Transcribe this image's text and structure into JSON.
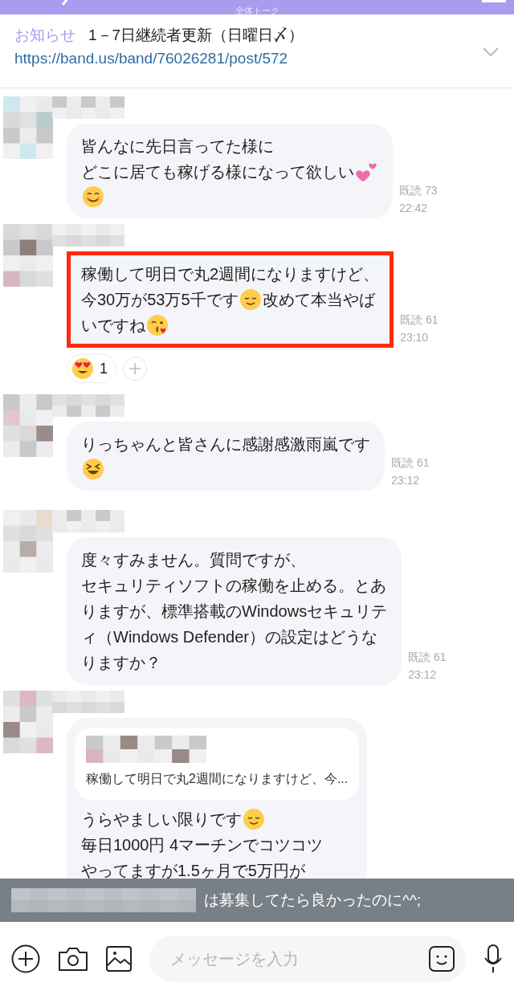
{
  "header": {
    "title": "全体トーク"
  },
  "notice": {
    "label": "お知らせ",
    "title": "1－7日継続者更新（日曜日〆）",
    "link": "https://band.us/band/76026281/post/572",
    "expanded": false
  },
  "messages": [
    {
      "highlighted": false,
      "lines": [
        [
          {
            "kind": "text",
            "text": "皆んなに先日言ってた様に"
          }
        ],
        [
          {
            "kind": "text",
            "text": "どこに居ても稼げる様になって欲しい"
          },
          {
            "kind": "hearts"
          }
        ],
        [
          {
            "kind": "smile"
          }
        ]
      ],
      "read": "既読 73",
      "time": "22:42"
    },
    {
      "highlighted": true,
      "lines": [
        [
          {
            "kind": "text",
            "text": "稼働して明日で丸2週間になりますけど、"
          }
        ],
        [
          {
            "kind": "text",
            "text": "今30万が53万5千です"
          },
          {
            "kind": "relieved"
          },
          {
            "kind": "text",
            "text": "改めて本当やば"
          }
        ],
        [
          {
            "kind": "text",
            "text": "いですね"
          },
          {
            "kind": "kiss"
          }
        ]
      ],
      "read": "既読 61",
      "time": "23:10",
      "reactions": [
        {
          "kind": "hearteyes",
          "count": "1"
        }
      ]
    },
    {
      "highlighted": false,
      "lines": [
        [
          {
            "kind": "text",
            "text": "りっちゃんと皆さんに感謝感激雨嵐です"
          }
        ],
        [
          {
            "kind": "laugh"
          }
        ]
      ],
      "read": "既読 61",
      "time": "23:12"
    },
    {
      "highlighted": false,
      "lines": [
        [
          {
            "kind": "text",
            "text": "度々すみません。質問ですが、"
          }
        ],
        [
          {
            "kind": "text",
            "text": "セキュリティソフトの稼働を止める。とあ"
          }
        ],
        [
          {
            "kind": "text",
            "text": "りますが、標準搭載のWindowsセキュリテ"
          }
        ],
        [
          {
            "kind": "text",
            "text": "ィ（Windows Defender）の設定はどうな"
          }
        ],
        [
          {
            "kind": "text",
            "text": "りますか？"
          }
        ]
      ],
      "read": "既読 61",
      "time": "23:12"
    },
    {
      "highlighted": false,
      "quote": {
        "text": "稼働して明日で丸2週間になりますけど、今..."
      },
      "lines": [
        [
          {
            "kind": "text",
            "text": "うらやましい限りです"
          },
          {
            "kind": "relieved"
          }
        ],
        [
          {
            "kind": "text",
            "text": "毎日1000円 4マーチンでコツコツ"
          }
        ],
        [
          {
            "kind": "text",
            "text": "やってますが1.5ヶ月で5万円が"
          }
        ]
      ]
    }
  ],
  "toast": {
    "text": "は募集してたら良かったのに^^;"
  },
  "composer": {
    "placeholder": "メッセージを入力"
  }
}
